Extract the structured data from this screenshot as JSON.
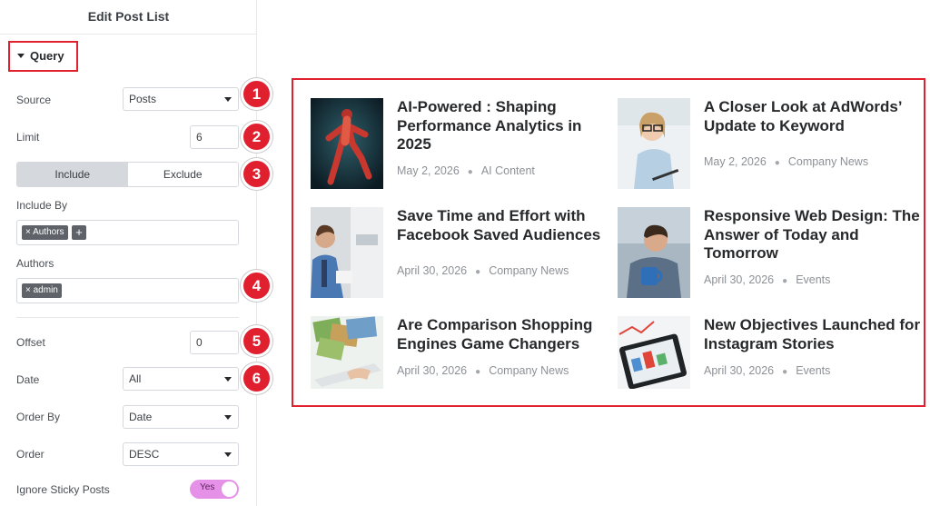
{
  "panel": {
    "title": "Edit Post List",
    "section": "Query",
    "fields": {
      "source_label": "Source",
      "source_value": "Posts",
      "limit_label": "Limit",
      "limit_value": "6",
      "include_tab": "Include",
      "exclude_tab": "Exclude",
      "include_by_label": "Include By",
      "include_by_chip": "× Authors",
      "include_by_add": "+",
      "authors_label": "Authors",
      "authors_chip": "× admin",
      "offset_label": "Offset",
      "offset_value": "0",
      "date_label": "Date",
      "date_value": "All",
      "order_by_label": "Order By",
      "order_by_value": "Date",
      "order_label": "Order",
      "order_value": "DESC",
      "sticky_label": "Ignore Sticky Posts",
      "sticky_value": "Yes"
    },
    "badges": [
      "1",
      "2",
      "3",
      "4",
      "5",
      "6"
    ]
  },
  "posts": [
    {
      "title": "AI-Powered : Shaping Performance Analytics in 2025",
      "date": "May 2, 2026",
      "category": "AI Content",
      "thumb": "anatomy-runner-image"
    },
    {
      "title": "A Closer Look at AdWords’ Update to Keyword",
      "date": "May 2, 2026",
      "category": "Company News",
      "thumb": "woman-with-glasses-image"
    },
    {
      "title": "Save Time and Effort with Facebook Saved Audiences",
      "date": "April 30, 2026",
      "category": "Company News",
      "thumb": "office-man-image"
    },
    {
      "title": "Responsive Web Design: The Answer of Today and Tomorrow",
      "date": "April 30, 2026",
      "category": "Events",
      "thumb": "man-with-mug-image"
    },
    {
      "title": "Are Comparison Shopping Engines Game Changers",
      "date": "April 30, 2026",
      "category": "Company News",
      "thumb": "laptop-photos-image"
    },
    {
      "title": "New Objectives Launched for Instagram Stories",
      "date": "April 30, 2026",
      "category": "Events",
      "thumb": "tablet-charts-image"
    }
  ],
  "colors": {
    "highlight": "#e0202f",
    "toggle": "#e591e8",
    "active_tab": "#d5d8dc"
  }
}
